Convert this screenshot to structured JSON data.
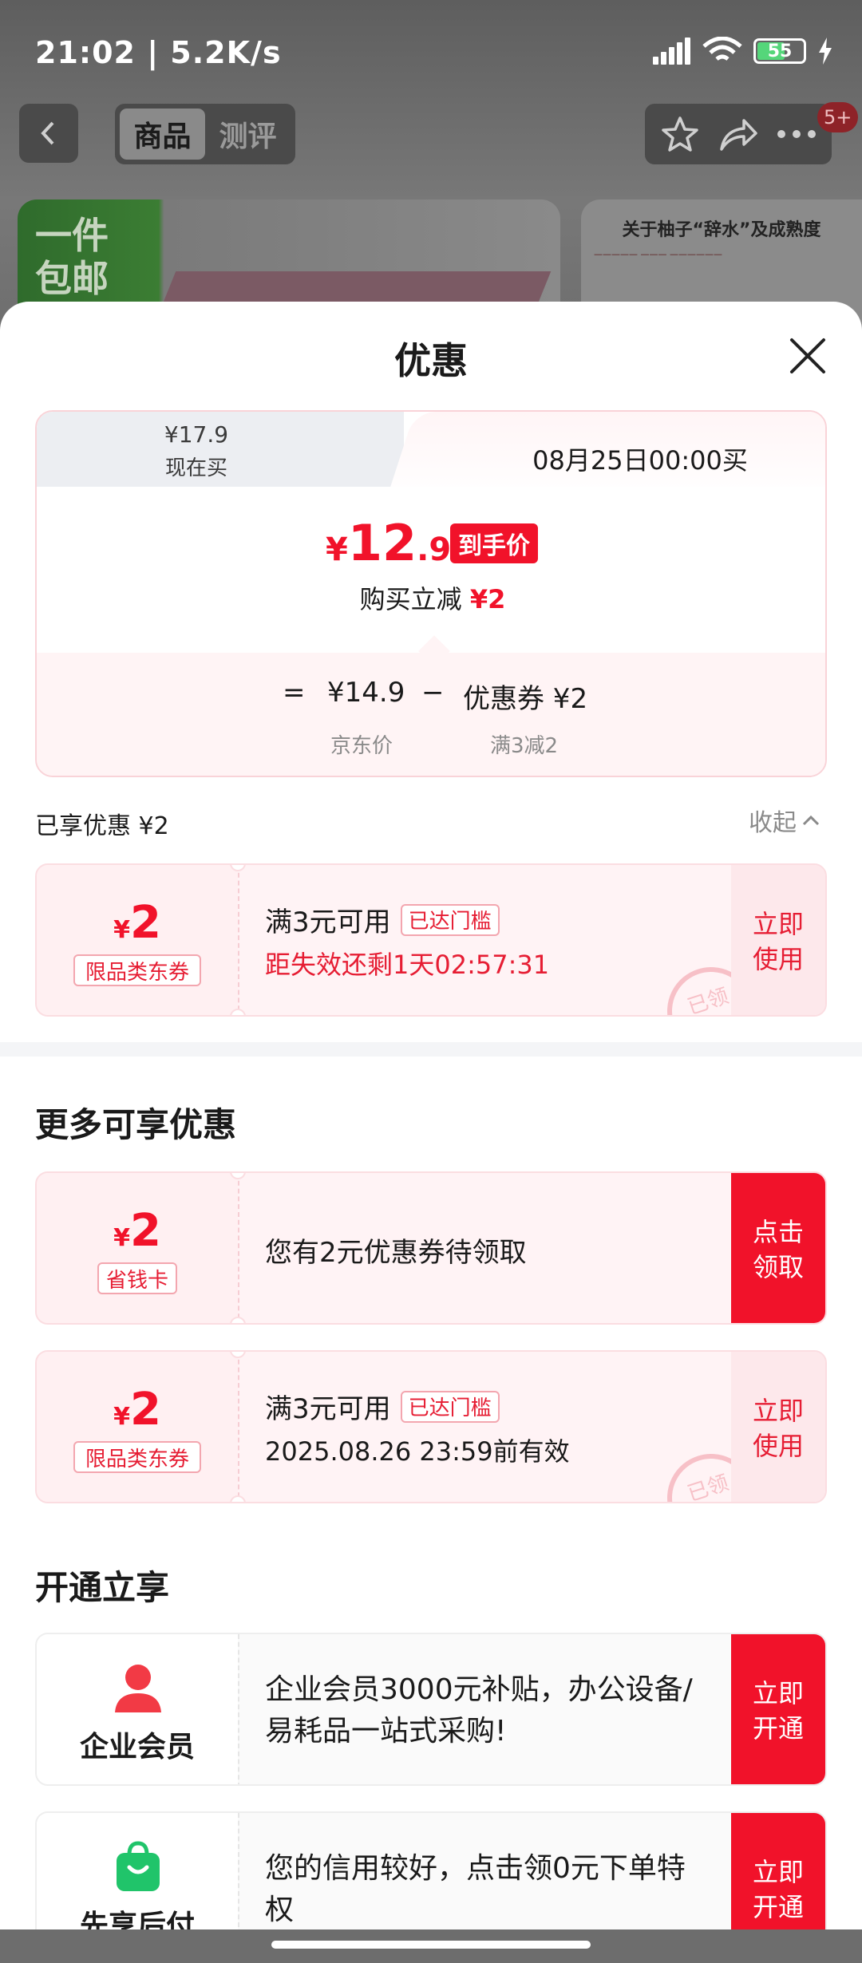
{
  "status_bar": {
    "time": "21:02 | 5.2K/s",
    "battery": "55"
  },
  "nav": {
    "tabs": [
      "商品",
      "测评"
    ],
    "badge": "5+"
  },
  "banner": {
    "left_text_1": "一件",
    "left_text_2": "包邮",
    "right_title": "关于柚子“辞水”及成熟度"
  },
  "sheet": {
    "title": "优惠",
    "price_card": {
      "now_price": "¥17.9",
      "now_label": "现在买",
      "future_label": "08月25日00:00买",
      "final_yen": "¥",
      "final_int": "12",
      "final_dec": ".9",
      "final_tag": "到手价",
      "reduce_text": "购买立减",
      "reduce_amount": "¥2",
      "eq": "=",
      "jd_price": "¥14.9",
      "minus": "−",
      "coupon_part": "优惠券 ¥2",
      "jd_price_label": "京东价",
      "coupon_rule": "满3减2"
    },
    "enjoyed": {
      "label": "已享优惠 ¥2",
      "collapse": "收起"
    },
    "coupon_applied": {
      "yen": "¥",
      "value": "2",
      "type": "限品类东券",
      "condition": "满3元可用",
      "reached": "已达门槛",
      "expire": "距失效还剩1天02:57:31",
      "action": "立即\n使用",
      "action_1": "立即",
      "action_2": "使用",
      "stamp": "已领"
    },
    "more_title": "更多可享优惠",
    "coupon_save_card": {
      "yen": "¥",
      "value": "2",
      "type": "省钱卡",
      "text": "您有2元优惠券待领取",
      "action_1": "点击",
      "action_2": "领取"
    },
    "coupon_second": {
      "yen": "¥",
      "value": "2",
      "type": "限品类东券",
      "condition": "满3元可用",
      "reached": "已达门槛",
      "valid": "2025.08.26 23:59前有效",
      "action_1": "立即",
      "action_2": "使用",
      "stamp": "已领"
    },
    "open_title": "开通立享",
    "enterprise": {
      "name": "企业会员",
      "text": "企业会员3000元补贴，办公设备/易耗品一站式采购!",
      "action_1": "立即",
      "action_2": "开通"
    },
    "pay_later": {
      "name": "先享后付",
      "text": "您的信用较好，点击领0元下单特权",
      "action_1": "立即",
      "action_2": "开通"
    }
  },
  "colors": {
    "accent": "#f1122a",
    "pale_pink": "#fff3f5",
    "sheet_bg": "#ffffff"
  },
  "icons": [
    "back-icon",
    "star-icon",
    "share-icon",
    "more-icon",
    "close-icon",
    "chevron-up-icon",
    "person-icon",
    "shopping-bag-icon"
  ]
}
